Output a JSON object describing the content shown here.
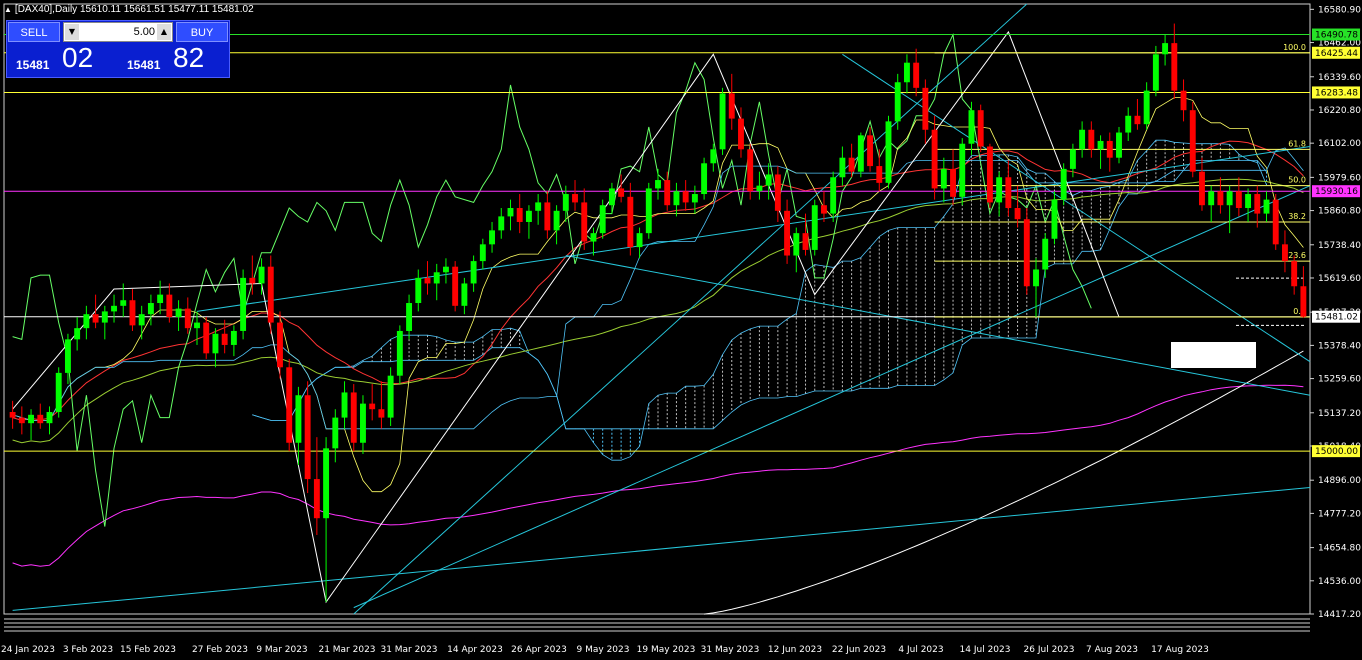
{
  "header": {
    "symbol": "[DAX40],Daily",
    "ohlc": "15610.11 15661.51 15477.11 15481.02"
  },
  "trade_panel": {
    "sell_label": "SELL",
    "buy_label": "BUY",
    "lot_value": "5.00",
    "sell_small": "15481",
    "sell_big": "02",
    "buy_small": "15481",
    "buy_big": "82"
  },
  "chart_data": {
    "type": "candlestick",
    "ylim": [
      14417.2,
      16600
    ],
    "y_ticks": [
      "16580.90",
      "16462.00",
      "16339.60",
      "16220.80",
      "16102.00",
      "15979.60",
      "15860.80",
      "15738.40",
      "15619.60",
      "15497.20",
      "15378.40",
      "15259.60",
      "15137.20",
      "15018.40",
      "14896.00",
      "14777.20",
      "14654.80",
      "14536.00",
      "14417.20"
    ],
    "x_labels": [
      "24 Jan 2023",
      "3 Feb 2023",
      "15 Feb 2023",
      "27 Feb 2023",
      "9 Mar 2023",
      "21 Mar 2023",
      "31 Mar 2023",
      "14 Apr 2023",
      "26 Apr 2023",
      "9 May 2023",
      "19 May 2023",
      "31 May 2023",
      "12 Jun 2023",
      "22 Jun 2023",
      "4 Jul 2023",
      "14 Jul 2023",
      "26 Jul 2023",
      "7 Aug 2023",
      "17 Aug 2023"
    ],
    "candles": [
      [
        15140,
        15180,
        15080,
        15120
      ],
      [
        15120,
        15160,
        15060,
        15100
      ],
      [
        15100,
        15150,
        15040,
        15130
      ],
      [
        15130,
        15170,
        15080,
        15100
      ],
      [
        15100,
        15160,
        15060,
        15140
      ],
      [
        15140,
        15300,
        15120,
        15280
      ],
      [
        15280,
        15420,
        15240,
        15400
      ],
      [
        15400,
        15480,
        15360,
        15440
      ],
      [
        15440,
        15520,
        15400,
        15490
      ],
      [
        15490,
        15560,
        15440,
        15460
      ],
      [
        15460,
        15520,
        15400,
        15500
      ],
      [
        15500,
        15560,
        15460,
        15520
      ],
      [
        15520,
        15600,
        15480,
        15540
      ],
      [
        15540,
        15580,
        15430,
        15450
      ],
      [
        15450,
        15520,
        15400,
        15490
      ],
      [
        15490,
        15560,
        15450,
        15530
      ],
      [
        15530,
        15610,
        15490,
        15560
      ],
      [
        15560,
        15600,
        15460,
        15480
      ],
      [
        15480,
        15540,
        15430,
        15510
      ],
      [
        15510,
        15550,
        15420,
        15440
      ],
      [
        15440,
        15500,
        15380,
        15460
      ],
      [
        15460,
        15480,
        15330,
        15350
      ],
      [
        15350,
        15440,
        15300,
        15420
      ],
      [
        15420,
        15470,
        15350,
        15380
      ],
      [
        15380,
        15450,
        15340,
        15430
      ],
      [
        15430,
        15650,
        15400,
        15620
      ],
      [
        15620,
        15700,
        15560,
        15600
      ],
      [
        15600,
        15690,
        15560,
        15660
      ],
      [
        15660,
        15700,
        15420,
        15460
      ],
      [
        15460,
        15500,
        15260,
        15300
      ],
      [
        15300,
        15330,
        15000,
        15030
      ],
      [
        15030,
        15230,
        14950,
        15200
      ],
      [
        15200,
        15250,
        14850,
        14900
      ],
      [
        14900,
        15050,
        14700,
        14760
      ],
      [
        14760,
        15050,
        14460,
        15010
      ],
      [
        15010,
        15150,
        14960,
        15120
      ],
      [
        15120,
        15250,
        15080,
        15210
      ],
      [
        15210,
        15240,
        15000,
        15030
      ],
      [
        15030,
        15200,
        14990,
        15170
      ],
      [
        15170,
        15240,
        15110,
        15150
      ],
      [
        15150,
        15250,
        15080,
        15120
      ],
      [
        15120,
        15300,
        15090,
        15270
      ],
      [
        15270,
        15450,
        15240,
        15430
      ],
      [
        15430,
        15560,
        15400,
        15530
      ],
      [
        15530,
        15650,
        15500,
        15620
      ],
      [
        15620,
        15680,
        15560,
        15600
      ],
      [
        15600,
        15670,
        15540,
        15640
      ],
      [
        15640,
        15690,
        15600,
        15660
      ],
      [
        15660,
        15680,
        15500,
        15520
      ],
      [
        15520,
        15620,
        15490,
        15600
      ],
      [
        15600,
        15700,
        15570,
        15680
      ],
      [
        15680,
        15760,
        15650,
        15740
      ],
      [
        15740,
        15820,
        15710,
        15790
      ],
      [
        15790,
        15870,
        15760,
        15840
      ],
      [
        15840,
        15900,
        15790,
        15870
      ],
      [
        15870,
        15920,
        15780,
        15820
      ],
      [
        15820,
        15880,
        15760,
        15860
      ],
      [
        15860,
        15920,
        15810,
        15890
      ],
      [
        15890,
        15930,
        15760,
        15790
      ],
      [
        15790,
        15880,
        15740,
        15860
      ],
      [
        15860,
        15950,
        15820,
        15920
      ],
      [
        15920,
        15970,
        15860,
        15890
      ],
      [
        15890,
        15940,
        15720,
        15750
      ],
      [
        15750,
        15800,
        15700,
        15780
      ],
      [
        15780,
        15900,
        15760,
        15880
      ],
      [
        15880,
        15960,
        15850,
        15940
      ],
      [
        15940,
        15990,
        15890,
        15910
      ],
      [
        15910,
        15960,
        15700,
        15730
      ],
      [
        15730,
        15800,
        15690,
        15780
      ],
      [
        15780,
        15960,
        15760,
        15940
      ],
      [
        15940,
        16010,
        15900,
        15970
      ],
      [
        15970,
        16000,
        15860,
        15880
      ],
      [
        15880,
        15960,
        15840,
        15930
      ],
      [
        15930,
        15970,
        15860,
        15890
      ],
      [
        15890,
        15950,
        15850,
        15920
      ],
      [
        15920,
        16050,
        15900,
        16030
      ],
      [
        16030,
        16100,
        16000,
        16080
      ],
      [
        16080,
        16300,
        16060,
        16280
      ],
      [
        16280,
        16350,
        16150,
        16190
      ],
      [
        16190,
        16230,
        16050,
        16080
      ],
      [
        16080,
        16100,
        15900,
        15930
      ],
      [
        15930,
        16000,
        15900,
        15950
      ],
      [
        15950,
        16030,
        15900,
        15990
      ],
      [
        15990,
        16020,
        15820,
        15860
      ],
      [
        15860,
        15900,
        15670,
        15700
      ],
      [
        15700,
        15800,
        15640,
        15780
      ],
      [
        15780,
        15850,
        15700,
        15720
      ],
      [
        15720,
        15900,
        15700,
        15880
      ],
      [
        15880,
        15930,
        15820,
        15850
      ],
      [
        15850,
        16000,
        15820,
        15980
      ],
      [
        15980,
        16090,
        15950,
        16050
      ],
      [
        16050,
        16100,
        15980,
        16000
      ],
      [
        16000,
        16140,
        15980,
        16130
      ],
      [
        16130,
        16160,
        16000,
        16020
      ],
      [
        16020,
        16080,
        15930,
        15960
      ],
      [
        15960,
        16200,
        15940,
        16180
      ],
      [
        16180,
        16350,
        16150,
        16320
      ],
      [
        16320,
        16420,
        16280,
        16390
      ],
      [
        16390,
        16440,
        16270,
        16300
      ],
      [
        16300,
        16330,
        16100,
        16150
      ],
      [
        16150,
        16200,
        15900,
        15940
      ],
      [
        15940,
        16050,
        15890,
        16010
      ],
      [
        16010,
        16080,
        15880,
        15910
      ],
      [
        15910,
        16120,
        15880,
        16100
      ],
      [
        16100,
        16250,
        16060,
        16220
      ],
      [
        16220,
        16240,
        16070,
        16090
      ],
      [
        16090,
        16100,
        15870,
        15890
      ],
      [
        15890,
        16000,
        15840,
        15980
      ],
      [
        15980,
        16040,
        15840,
        15870
      ],
      [
        15870,
        15950,
        15800,
        15830
      ],
      [
        15830,
        15870,
        15560,
        15590
      ],
      [
        15590,
        15690,
        15480,
        15650
      ],
      [
        15650,
        15780,
        15620,
        15760
      ],
      [
        15760,
        15930,
        15740,
        15900
      ],
      [
        15900,
        16030,
        15880,
        16010
      ],
      [
        16010,
        16100,
        15980,
        16080
      ],
      [
        16080,
        16180,
        16050,
        16150
      ],
      [
        16150,
        16180,
        16050,
        16080
      ],
      [
        16080,
        16130,
        16010,
        16110
      ],
      [
        16110,
        16140,
        16000,
        16050
      ],
      [
        16050,
        16160,
        16030,
        16140
      ],
      [
        16140,
        16230,
        16110,
        16200
      ],
      [
        16200,
        16260,
        16150,
        16170
      ],
      [
        16170,
        16320,
        16150,
        16290
      ],
      [
        16290,
        16450,
        16270,
        16420
      ],
      [
        16420,
        16490,
        16380,
        16460
      ],
      [
        16460,
        16530,
        16260,
        16290
      ],
      [
        16290,
        16330,
        16180,
        16220
      ],
      [
        16220,
        16250,
        15980,
        16000
      ],
      [
        16000,
        16050,
        15860,
        15880
      ],
      [
        15880,
        15950,
        15820,
        15930
      ],
      [
        15930,
        15980,
        15850,
        15880
      ],
      [
        15880,
        15950,
        15780,
        15930
      ],
      [
        15930,
        15980,
        15840,
        15870
      ],
      [
        15870,
        15940,
        15820,
        15920
      ],
      [
        15920,
        15950,
        15800,
        15850
      ],
      [
        15850,
        15930,
        15820,
        15900
      ],
      [
        15900,
        15920,
        15720,
        15740
      ],
      [
        15740,
        15790,
        15640,
        15680
      ],
      [
        15680,
        15700,
        15560,
        15590
      ],
      [
        15590,
        15662,
        15477,
        15481
      ]
    ],
    "levels": [
      {
        "label": "16490.78",
        "value": 16490.78,
        "color": "#27e127"
      },
      {
        "label": "16425.44",
        "value": 16425.44,
        "color": "#ffff33"
      },
      {
        "label": "16283.48",
        "value": 16283.48,
        "color": "#ffff33"
      },
      {
        "label": "15930.16",
        "value": 15930.16,
        "color": "#ff33ff"
      },
      {
        "label": "15481.02",
        "value": 15481.02,
        "color": "#ffffff"
      },
      {
        "label": "15000.00",
        "value": 15000.0,
        "color": "#ffff33"
      }
    ],
    "fib_levels": [
      {
        "label": "100.0",
        "value": 16425
      },
      {
        "label": "61.8",
        "value": 16080
      },
      {
        "label": "50.0",
        "value": 15950
      },
      {
        "label": "38.2",
        "value": 15820
      },
      {
        "label": "23.6",
        "value": 15680
      },
      {
        "label": "0.0",
        "value": 15480
      }
    ]
  },
  "colors": {
    "bull": "#00ff00",
    "bear": "#ff0000",
    "tenkan": "#66ff66",
    "kijun": "#ffff66",
    "senkou": "#4fc3f7",
    "ma_red": "#ff3333",
    "ma_green": "#9acd32",
    "ma_magenta": "#ff33ff",
    "ma_white": "#ffffff",
    "trend": "#26c6da"
  }
}
